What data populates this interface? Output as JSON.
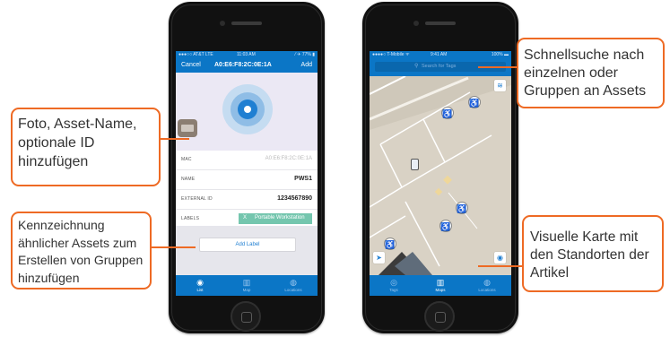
{
  "left_phone": {
    "status": {
      "carrier": "●●●○○ AT&T  LTE",
      "time": "11:03 AM",
      "battery": "⁄ ✈ 77% ▮"
    },
    "nav": {
      "cancel": "Cancel",
      "title": "A0:E6:F8:2C:0E:1A",
      "add": "Add"
    },
    "fields": [
      {
        "label": "MAC",
        "value": "A0:E6:F8:2C:0E:1A"
      },
      {
        "label": "NAME",
        "value": "PWS1"
      },
      {
        "label": "EXTERNAL ID",
        "value": "1234567890"
      },
      {
        "label": "LABELS",
        "value": "Portable Workstation"
      }
    ],
    "tag_remove": "X",
    "add_label": "Add Label",
    "tabs": [
      {
        "label": "List",
        "icon": "list-icon",
        "glyph": "◉"
      },
      {
        "label": "Map",
        "icon": "map-icon",
        "glyph": "▥"
      },
      {
        "label": "Locations",
        "icon": "globe-icon",
        "glyph": "◍"
      }
    ]
  },
  "right_phone": {
    "status": {
      "carrier": "●●●●○ T-Mobile ᯤ",
      "time": "9:41 AM",
      "battery": "100% ▬"
    },
    "search": {
      "placeholder": "Search for Tags",
      "icon": "search-icon",
      "glyph": "⚲"
    },
    "tabs": [
      {
        "label": "Tags",
        "icon": "tags-icon",
        "glyph": "◎"
      },
      {
        "label": "Maps",
        "icon": "map-icon",
        "glyph": "▥"
      },
      {
        "label": "Locations",
        "icon": "globe-icon",
        "glyph": "◍"
      }
    ],
    "map_buttons": {
      "layers": "≋",
      "locate": "➤",
      "view": "◉"
    },
    "wheelchair_glyph": "♿"
  },
  "callouts": {
    "photo": "Foto, Asset-Name, optionale ID hinzufügen",
    "labels": "Kennzeichnung ähnlicher Assets zum Erstellen von Gruppen hinzufügen",
    "search": "Schnellsuche nach einzelnen oder Gruppen an Assets",
    "map": "Visuelle Karte mit den Standorten der Artikel"
  },
  "colors": {
    "accent": "#0b76c6",
    "callout_border": "#ee6a24",
    "tag": "#74c6ae"
  }
}
